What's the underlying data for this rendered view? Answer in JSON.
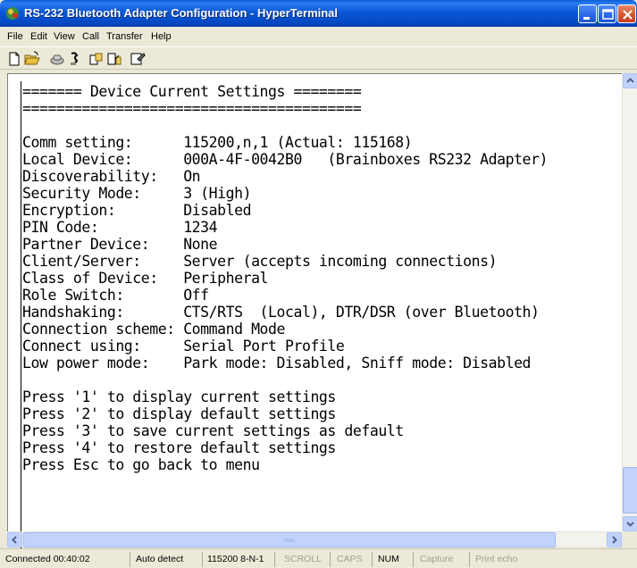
{
  "window": {
    "title": "RS-232 Bluetooth Adapter Configuration - HyperTerminal",
    "title_color": "#0b58d6"
  },
  "menu": {
    "items": [
      "File",
      "Edit",
      "View",
      "Call",
      "Transfer",
      "Help"
    ]
  },
  "toolbar": {
    "icons": [
      "new-icon",
      "open-icon",
      "connect-icon",
      "disconnect-icon",
      "send-icon",
      "receive-icon",
      "properties-icon"
    ]
  },
  "terminal": {
    "lines": [
      "======= Device Current Settings ========",
      "========================================",
      "",
      "Comm setting:      115200,n,1 (Actual: 115168)",
      "Local Device:      000A-4F-0042B0   (Brainboxes RS232 Adapter)",
      "Discoverability:   On",
      "Security Mode:     3 (High)",
      "Encryption:        Disabled",
      "PIN Code:          1234",
      "Partner Device:    None",
      "Client/Server:     Server (accepts incoming connections)",
      "Class of Device:   Peripheral",
      "Role Switch:       Off",
      "Handshaking:       CTS/RTS  (Local), DTR/DSR (over Bluetooth)",
      "Connection scheme: Command Mode",
      "Connect using:     Serial Port Profile",
      "Low power mode:    Park mode: Disabled, Sniff mode: Disabled",
      "",
      "Press '1' to display current settings",
      "Press '2' to display default settings",
      "Press '3' to save current settings as default",
      "Press '4' to restore default settings",
      "Press Esc to go back to menu"
    ]
  },
  "status": {
    "connected": "Connected 00:40:02",
    "detect": "Auto detect",
    "settings": "115200 8-N-1",
    "scroll": "SCROLL",
    "caps": "CAPS",
    "num": "NUM",
    "capture": "Capture",
    "print_echo": "Print echo"
  }
}
